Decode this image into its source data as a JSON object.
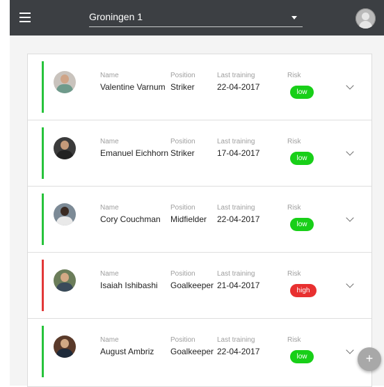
{
  "header": {
    "menu_icon": "menu-icon",
    "team_selector": "Groningen 1",
    "avatar_icon": "user-avatar-icon"
  },
  "columns": {
    "name": "Name",
    "position": "Position",
    "last_training": "Last training",
    "risk": "Risk"
  },
  "players": [
    {
      "name": "Valentine Varnum",
      "position": "Striker",
      "last_training": "22-04-2017",
      "risk": "low",
      "status_color": "#27c33b",
      "risk_color": "#18cf18"
    },
    {
      "name": "Emanuel Eichhorn",
      "position": "Striker",
      "last_training": "17-04-2017",
      "risk": "low",
      "status_color": "#27c33b",
      "risk_color": "#18cf18"
    },
    {
      "name": "Cory Couchman",
      "position": "Midfielder",
      "last_training": "22-04-2017",
      "risk": "low",
      "status_color": "#27c33b",
      "risk_color": "#18cf18"
    },
    {
      "name": "Isaiah Ishibashi",
      "position": "Goalkeeper",
      "last_training": "21-04-2017",
      "risk": "high",
      "status_color": "#e23838",
      "risk_color": "#e83030"
    },
    {
      "name": "August Ambriz",
      "position": "Goalkeeper",
      "last_training": "22-04-2017",
      "risk": "low",
      "status_color": "#27c33b",
      "risk_color": "#18cf18"
    }
  ],
  "fab": {
    "label": "+",
    "icon": "plus-icon"
  },
  "colors": {
    "topbar": "#3c3f43",
    "status_low": "#27c33b",
    "status_high": "#e23838"
  }
}
